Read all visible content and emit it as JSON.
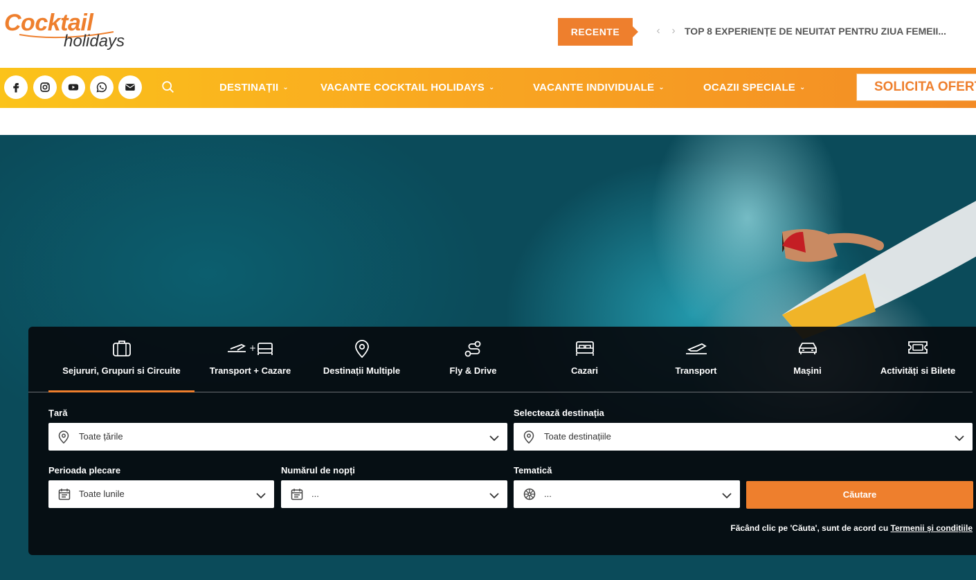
{
  "header": {
    "logo_top": "Cocktail",
    "logo_bottom": "holidays",
    "recente_label": "RECENTE",
    "news_prev": "‹",
    "news_next": "›",
    "news_title": "TOP 8 EXPERIENȚE DE NEUITAT PENTRU ZIUA FEMEII..."
  },
  "nav": {
    "social": [
      "facebook-icon",
      "instagram-icon",
      "youtube-icon",
      "whatsapp-icon",
      "email-icon"
    ],
    "items": [
      {
        "label": "DESTINAȚII"
      },
      {
        "label": "VACANTE COCKTAIL HOLIDAYS"
      },
      {
        "label": "VACANTE INDIVIDUALE"
      },
      {
        "label": "OCAZII SPECIALE"
      }
    ],
    "cta_label": "SOLICITA OFERTA"
  },
  "search": {
    "tabs": [
      {
        "label": "Sejururi, Grupuri si Circuite",
        "icon": "suitcase-icon"
      },
      {
        "label": "Transport + Cazare",
        "icon": "plane-bed-icon"
      },
      {
        "label": "Destinații Multiple",
        "icon": "map-pin-icon"
      },
      {
        "label": "Fly & Drive",
        "icon": "route-icon"
      },
      {
        "label": "Cazari",
        "icon": "bed-icon"
      },
      {
        "label": "Transport",
        "icon": "plane-icon"
      },
      {
        "label": "Mașini",
        "icon": "car-icon"
      },
      {
        "label": "Activități si Bilete",
        "icon": "ticket-icon"
      }
    ],
    "country_label": "Țară",
    "country_value": "Toate țările",
    "destination_label": "Selectează destinația",
    "destination_value": "Toate destinațiile",
    "period_label": "Perioada plecare",
    "period_value": "Toate lunile",
    "nights_label": "Numărul de nopți",
    "nights_value": "...",
    "theme_label": "Tematică",
    "theme_value": "...",
    "search_button": "Căutare",
    "terms_text": "Făcând clic pe 'Căuta', sunt de acord cu ",
    "terms_link": "Termenii și condițiile"
  },
  "colors": {
    "accent": "#ee7f2d",
    "nav_start": "#fbc31a",
    "nav_end": "#f38b25",
    "panel": "#06090d"
  }
}
